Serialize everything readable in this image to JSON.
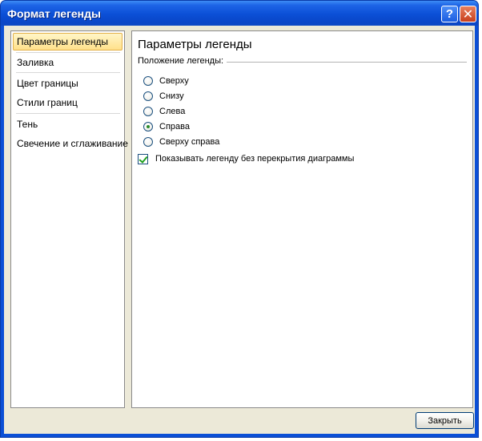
{
  "window": {
    "title": "Формат легенды",
    "help_label": "?",
    "close_label": "✕"
  },
  "nav": {
    "items": [
      {
        "label": "Параметры легенды",
        "selected": true
      },
      {
        "label": "Заливка"
      },
      {
        "label": "Цвет границы"
      },
      {
        "label": "Стили границ"
      },
      {
        "label": "Тень"
      },
      {
        "label": "Свечение и сглаживание"
      }
    ]
  },
  "panel": {
    "title": "Параметры легенды",
    "position_label": "Положение легенды:",
    "options": [
      {
        "label": "Сверху",
        "checked": false
      },
      {
        "label": "Снизу",
        "checked": false
      },
      {
        "label": "Слева",
        "checked": false
      },
      {
        "label": "Справа",
        "checked": true
      },
      {
        "label": "Сверху справа",
        "checked": false
      }
    ],
    "no_overlap_label": "Показывать легенду без перекрытия диаграммы",
    "no_overlap_checked": true
  },
  "footer": {
    "close_label": "Закрыть"
  }
}
